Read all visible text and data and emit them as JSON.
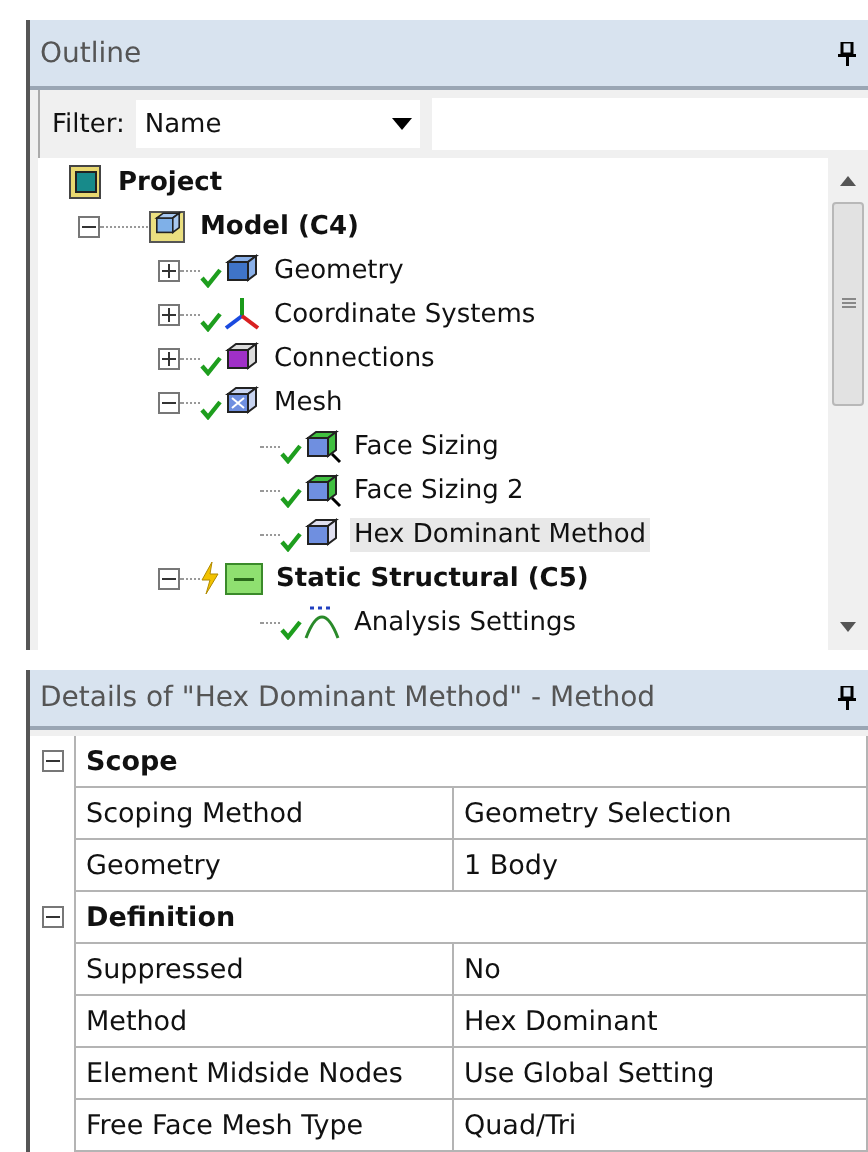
{
  "outline": {
    "title": "Outline",
    "filter": {
      "label": "Filter:",
      "value": "Name"
    },
    "tree": [
      {
        "label": "Project",
        "kind": "project",
        "bold": true,
        "selected": false,
        "children": [
          {
            "label": "Model (C4)",
            "kind": "model",
            "bold": true,
            "selected": false,
            "expanded": true,
            "children": [
              {
                "label": "Geometry",
                "kind": "geometry",
                "solved": true,
                "bold": false,
                "selected": false,
                "expanded": false
              },
              {
                "label": "Coordinate Systems",
                "kind": "axes",
                "solved": true,
                "bold": false,
                "selected": false,
                "expanded": false
              },
              {
                "label": "Connections",
                "kind": "connections",
                "solved": true,
                "bold": false,
                "selected": false,
                "expanded": false
              },
              {
                "label": "Mesh",
                "kind": "mesh",
                "solved": true,
                "bold": false,
                "selected": false,
                "expanded": true,
                "children": [
                  {
                    "label": "Face Sizing",
                    "kind": "sizing",
                    "solved": true,
                    "bold": false,
                    "selected": false
                  },
                  {
                    "label": "Face Sizing 2",
                    "kind": "sizing",
                    "solved": true,
                    "bold": false,
                    "selected": false
                  },
                  {
                    "label": "Hex Dominant Method",
                    "kind": "method",
                    "solved": true,
                    "bold": false,
                    "selected": true
                  }
                ]
              },
              {
                "label": "Static Structural (C5)",
                "kind": "analysis",
                "solved": false,
                "bold": true,
                "selected": false,
                "expanded": true,
                "children": [
                  {
                    "label": "Analysis Settings",
                    "kind": "settings",
                    "solved": true,
                    "bold": false,
                    "selected": false
                  }
                ]
              }
            ]
          }
        ]
      }
    ]
  },
  "details": {
    "title": "Details of \"Hex Dominant Method\" - Method",
    "sections": [
      {
        "name": "Scope",
        "expanded": true,
        "rows": [
          {
            "property": "Scoping Method",
            "value": "Geometry Selection"
          },
          {
            "property": "Geometry",
            "value": "1 Body"
          }
        ]
      },
      {
        "name": "Definition",
        "expanded": true,
        "rows": [
          {
            "property": "Suppressed",
            "value": "No"
          },
          {
            "property": "Method",
            "value": "Hex Dominant"
          },
          {
            "property": "Element Midside Nodes",
            "value": "Use Global Setting"
          },
          {
            "property": "Free Face Mesh Type",
            "value": "Quad/Tri"
          }
        ]
      }
    ]
  }
}
